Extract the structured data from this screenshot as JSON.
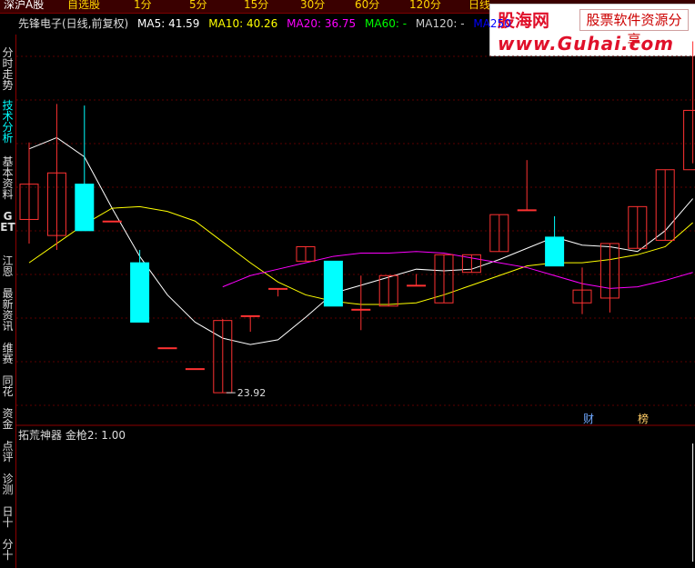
{
  "top_tabs": [
    "深沪A股",
    "自选股",
    "1分",
    "5分",
    "15分",
    "30分",
    "60分",
    "120分",
    "日线"
  ],
  "watermark": {
    "brand_cn": "股海网",
    "slogan": "股票软件资源分享",
    "url": "www.Guhai.com"
  },
  "stock_title": "先锋电子(日线,前复权)",
  "ma_legend": [
    {
      "label": "MA5: 41.59",
      "color": "#ffffff"
    },
    {
      "label": "MA10: 40.26",
      "color": "#ffff00"
    },
    {
      "label": "MA20: 36.75",
      "color": "#ff00ff"
    },
    {
      "label": "MA60: -",
      "color": "#00ff00"
    },
    {
      "label": "MA120: -",
      "color": "#cccccc"
    },
    {
      "label": "MA250",
      "color": "#0000ff"
    }
  ],
  "sidebar": [
    "分时走势",
    "技术分析",
    "基本资料",
    "GET",
    "江恩",
    "最新资讯",
    "维赛",
    "同花",
    "资金",
    "点评",
    "诊测",
    "日十",
    "分十"
  ],
  "low_label": "23.92",
  "badges": {
    "cai": "财",
    "bang": "榜"
  },
  "sub_indicator": "拓荒神器  金枪2: 1.00",
  "colors": {
    "up": "#ff3232",
    "down": "#00ffff",
    "grid": "#5a0000",
    "border": "#8b0000"
  },
  "chart_data": {
    "type": "candlestick",
    "ylim": [
      23.0,
      46.0
    ],
    "candles": [
      {
        "open": 34.7,
        "close": 36.9,
        "high": 39.5,
        "low": 33.2
      },
      {
        "open": 33.7,
        "close": 37.6,
        "high": 41.9,
        "low": 32.8
      },
      {
        "open": 36.9,
        "close": 34.0,
        "high": 41.8,
        "low": 34.0
      },
      {
        "open": 34.6,
        "close": 34.6,
        "high": 34.6,
        "low": 34.6
      },
      {
        "open": 32.0,
        "close": 28.3,
        "high": 32.8,
        "low": 28.3
      },
      {
        "open": 26.7,
        "close": 26.7,
        "high": 26.7,
        "low": 26.7
      },
      {
        "open": 25.4,
        "close": 25.4,
        "high": 25.4,
        "low": 25.4
      },
      {
        "open": 23.9,
        "close": 28.4,
        "high": 28.5,
        "low": 23.9
      },
      {
        "open": 28.7,
        "close": 28.7,
        "high": 28.7,
        "low": 27.7
      },
      {
        "open": 30.4,
        "close": 30.4,
        "high": 30.4,
        "low": 29.9
      },
      {
        "open": 32.1,
        "close": 33.0,
        "high": 33.0,
        "low": 32.1
      },
      {
        "open": 32.1,
        "close": 29.3,
        "high": 32.1,
        "low": 29.3
      },
      {
        "open": 29.1,
        "close": 29.1,
        "high": 31.2,
        "low": 27.8
      },
      {
        "open": 29.3,
        "close": 31.2,
        "high": 31.2,
        "low": 29.3
      },
      {
        "open": 30.6,
        "close": 30.6,
        "high": 31.3,
        "low": 30.6
      },
      {
        "open": 29.5,
        "close": 32.5,
        "high": 32.5,
        "low": 29.5
      },
      {
        "open": 31.4,
        "close": 32.5,
        "high": 32.5,
        "low": 31.4
      },
      {
        "open": 32.7,
        "close": 35.0,
        "high": 35.0,
        "low": 32.7
      },
      {
        "open": 35.3,
        "close": 35.3,
        "high": 38.4,
        "low": 35.3
      },
      {
        "open": 33.6,
        "close": 31.8,
        "high": 34.9,
        "low": 31.8
      },
      {
        "open": 29.5,
        "close": 30.3,
        "high": 31.7,
        "low": 28.8
      },
      {
        "open": 29.8,
        "close": 33.2,
        "high": 33.2,
        "low": 28.9
      },
      {
        "open": 32.9,
        "close": 35.5,
        "high": 35.5,
        "low": 32.9
      },
      {
        "open": 33.4,
        "close": 37.8,
        "high": 37.8,
        "low": 33.4
      },
      {
        "open": 37.8,
        "close": 41.5,
        "high": 45.8,
        "low": 38.2
      }
    ],
    "ma5": [
      39.1,
      39.8,
      38.6,
      35.4,
      32.4,
      30.0,
      28.3,
      27.3,
      26.9,
      27.2,
      28.6,
      30.1,
      30.6,
      31.1,
      31.6,
      31.5,
      31.6,
      32.2,
      32.9,
      33.6,
      33.1,
      33.0,
      32.7,
      34.0,
      36.0
    ],
    "ma10": [
      32.0,
      33.2,
      34.4,
      35.4,
      35.5,
      35.2,
      34.6,
      33.3,
      32.0,
      30.8,
      30.0,
      29.6,
      29.4,
      29.4,
      29.5,
      30.0,
      30.6,
      31.2,
      31.8,
      32.0,
      32.0,
      32.2,
      32.5,
      33.0,
      34.5
    ],
    "ma20": [
      null,
      null,
      null,
      null,
      null,
      null,
      null,
      30.5,
      31.2,
      31.6,
      32.0,
      32.4,
      32.6,
      32.6,
      32.7,
      32.6,
      32.3,
      32.0,
      31.7,
      31.2,
      30.7,
      30.4,
      30.5,
      30.9,
      31.4
    ],
    "sub_values": [
      0,
      0,
      0,
      0,
      0,
      0,
      0,
      0,
      0,
      0,
      0,
      0,
      0,
      0,
      0,
      0,
      0,
      0,
      0,
      0,
      0,
      0,
      0,
      0,
      1.0
    ]
  }
}
